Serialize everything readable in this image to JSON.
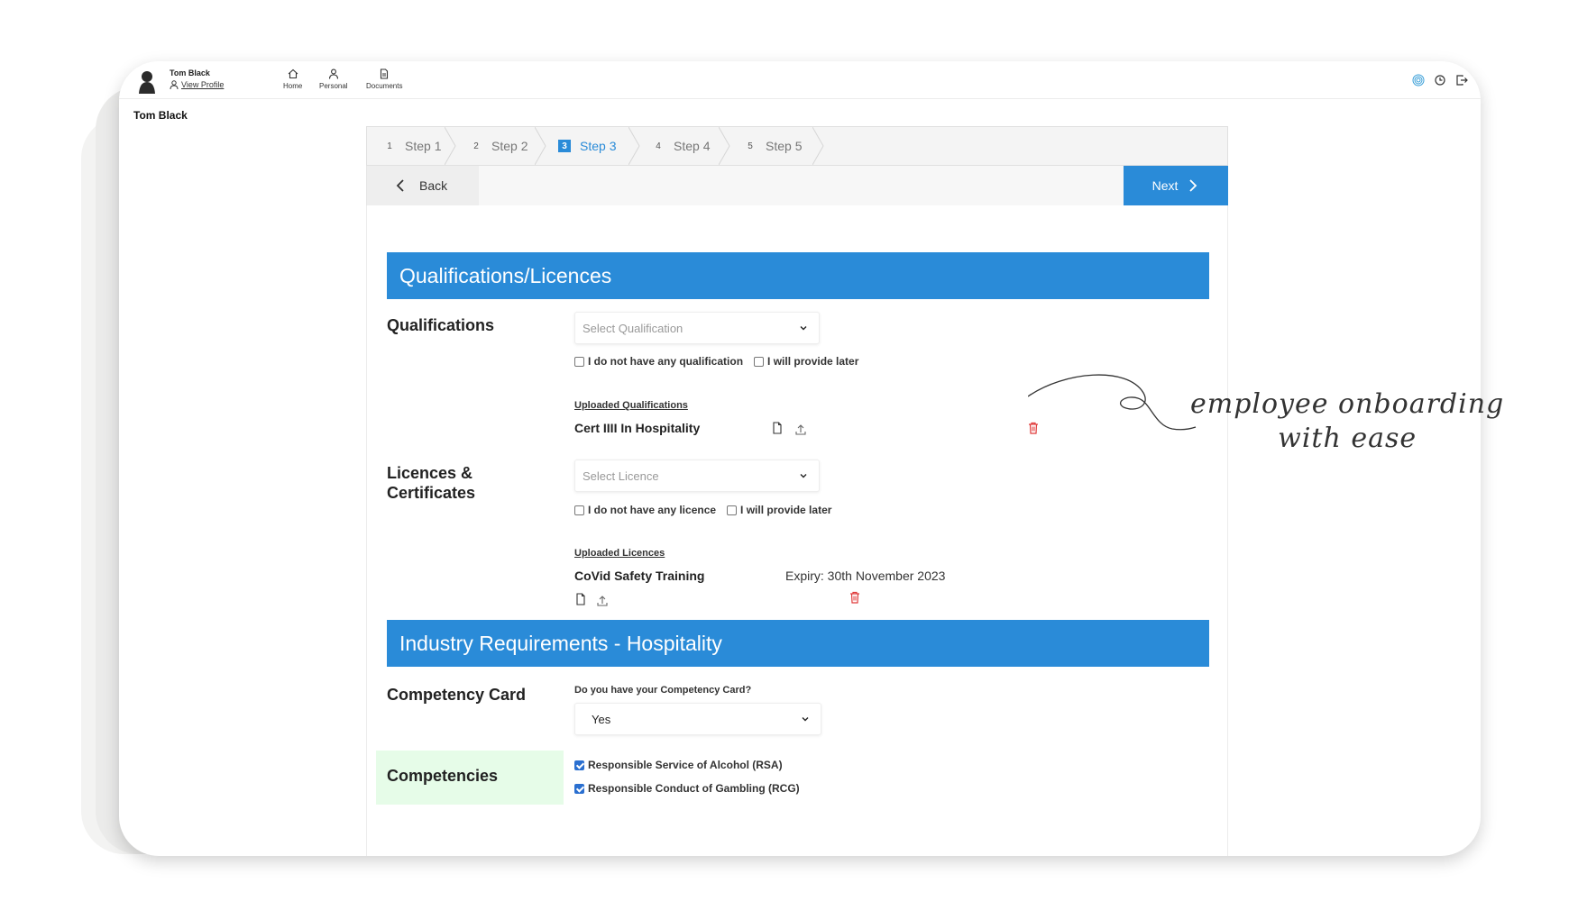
{
  "header": {
    "user_name": "Tom Black",
    "view_profile": "View Profile",
    "nav": [
      {
        "label": "Home",
        "icon": "home-icon"
      },
      {
        "label": "Personal",
        "icon": "person-icon"
      },
      {
        "label": "Documents",
        "icon": "document-icon"
      }
    ],
    "right_icons": [
      "fingerprint-icon",
      "clock-icon",
      "logout-icon"
    ]
  },
  "page_user": "Tom Black",
  "steps": [
    {
      "num": "1",
      "label": "Step 1",
      "active": false
    },
    {
      "num": "2",
      "label": "Step 2",
      "active": false
    },
    {
      "num": "3",
      "label": "Step 3",
      "active": true
    },
    {
      "num": "4",
      "label": "Step 4",
      "active": false
    },
    {
      "num": "5",
      "label": "Step 5",
      "active": false
    }
  ],
  "navigation": {
    "back": "Back",
    "next": "Next"
  },
  "qualifications_section": {
    "title": "Qualifications/Licences",
    "qualifications": {
      "label": "Qualifications",
      "select_placeholder": "Select Qualification",
      "no_option": "I do not have any qualification",
      "later_option": "I will provide later",
      "uploaded_heading": "Uploaded Qualifications",
      "uploaded_item": "Cert IIII In Hospitality"
    },
    "licences": {
      "label_line1": "Licences &",
      "label_line2": "Certificates",
      "select_placeholder": "Select Licence",
      "no_option": "I do not have any licence",
      "later_option": "I will provide later",
      "uploaded_heading": "Uploaded Licences",
      "uploaded_item": "CoVid Safety Training",
      "expiry": "Expiry: 30th November 2023"
    }
  },
  "industry_section": {
    "title": "Industry Requirements - Hospitality",
    "competency_card": {
      "label": "Competency Card",
      "question": "Do you have your Competency Card?",
      "value": "Yes"
    },
    "competencies": {
      "label": "Competencies",
      "items": [
        {
          "label": "Responsible Service of Alcohol (RSA)",
          "checked": true
        },
        {
          "label": "Responsible Conduct of Gambling (RCG)",
          "checked": true
        }
      ]
    }
  },
  "annotation": {
    "line1": "employee onboarding",
    "line2": "with ease"
  },
  "colors": {
    "accent": "#2a8bd8",
    "delete": "#e03a3a",
    "competency_bg": "#e6fce8"
  }
}
